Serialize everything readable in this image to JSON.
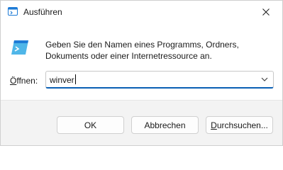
{
  "window": {
    "title": "Ausführen",
    "description_line1": "Geben Sie den Namen eines Programms, Ordners,",
    "description_line2": "Dokuments oder einer Internetressource an."
  },
  "field": {
    "label_mnemonic": "Ö",
    "label_rest": "ffnen:",
    "value": "winver"
  },
  "buttons": {
    "ok": "OK",
    "cancel": "Abbrechen",
    "browse_mnemonic": "D",
    "browse_rest": "urchsuchen..."
  },
  "icons": {
    "app": "run-app-icon",
    "body": "run-program-icon",
    "close": "close-icon",
    "dropdown": "chevron-down-icon"
  },
  "colors": {
    "accent": "#0a5fb4",
    "footer_bg": "#f3f3f3",
    "icon_blue": "#1e7bd6",
    "icon_teal": "#4fb6e8"
  }
}
